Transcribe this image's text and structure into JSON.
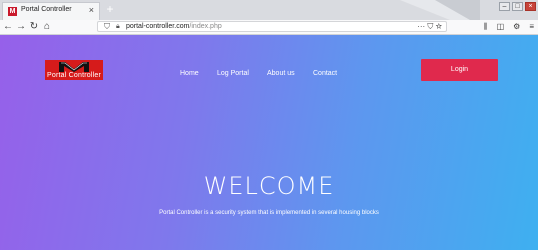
{
  "browser": {
    "tab_title": "Portal Controller",
    "tab_close": "×",
    "favicon_text": "M",
    "new_tab": "+",
    "url_host": "portal-controller.com",
    "url_path": "/index.php",
    "url_actions": "··· ⛉ ☆",
    "icons": [
      "back-icon",
      "forward-icon",
      "reload-icon",
      "home-icon",
      "shield-icon",
      "lock-icon",
      "library-icon",
      "sidebar-icon",
      "settings-icon",
      "menu-icon"
    ]
  },
  "page": {
    "logo_text": "Portal Controller",
    "menu": {
      "home": "Home",
      "log_portal": "Log Portal",
      "about": "About us",
      "contact": "Contact"
    },
    "login_label": "Login",
    "headline": "WELCOME",
    "subtitle": "Portal Controller is a security system that is implemented in several housing blocks"
  },
  "colors": {
    "gradient_start": "#9660ea",
    "gradient_end": "#3eb0f0",
    "login_button": "#e0294d",
    "logo_red": "#d61b1b"
  }
}
